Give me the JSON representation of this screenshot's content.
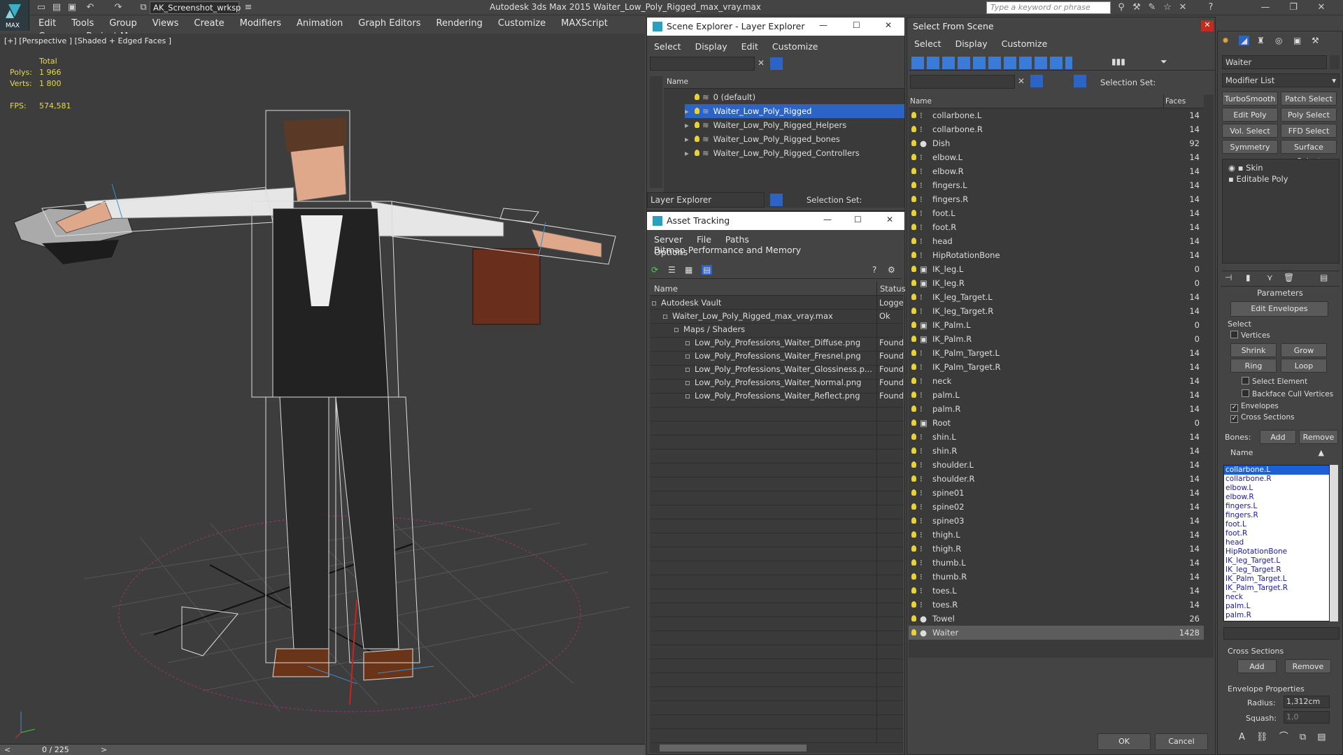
{
  "app": {
    "title": "Autodesk 3ds Max  2015    Waiter_Low_Poly_Rigged_max_vray.max",
    "workspace": "AK_Screenshot_wrksp",
    "search_placeholder": "Type a keyword or phrase",
    "logo_text": "MAX"
  },
  "menu": [
    "Edit",
    "Tools",
    "Group",
    "Views",
    "Create",
    "Modifiers",
    "Animation",
    "Graph Editors",
    "Rendering",
    "Customize",
    "MAXScript",
    "Corona",
    "Project Man"
  ],
  "viewport": {
    "label": "[+] [Perspective ] [Shaded + Edged Faces ]",
    "total_label": "Total",
    "polys_label": "Polys:",
    "polys_value": "1 966",
    "verts_label": "Verts:",
    "verts_value": "1 800",
    "fps_label": "FPS:",
    "fps_value": "574,581",
    "timeline": "0 / 225"
  },
  "scene_explorer": {
    "title": "Scene Explorer - Layer Explorer",
    "menu": [
      "Select",
      "Display",
      "Edit",
      "Customize"
    ],
    "column": "Name",
    "layers": [
      {
        "name": "0 (default)",
        "selected": false,
        "expand": false
      },
      {
        "name": "Waiter_Low_Poly_Rigged",
        "selected": true,
        "expand": true
      },
      {
        "name": "Waiter_Low_Poly_Rigged_Helpers",
        "selected": false,
        "expand": true
      },
      {
        "name": "Waiter_Low_Poly_Rigged_bones",
        "selected": false,
        "expand": true
      },
      {
        "name": "Waiter_Low_Poly_Rigged_Controllers",
        "selected": false,
        "expand": true
      }
    ],
    "footer_dropdown": "Layer Explorer",
    "selection_set": "Selection Set:"
  },
  "asset_tracking": {
    "title": "Asset Tracking",
    "menu": [
      "Server",
      "File",
      "Paths",
      "Bitmap Performance and Memory"
    ],
    "menu2": "Options",
    "col_name": "Name",
    "col_status": "Status",
    "rows": [
      {
        "name": "Autodesk Vault",
        "status": "Logge",
        "indent": 0
      },
      {
        "name": "Waiter_Low_Poly_Rigged_max_vray.max",
        "status": "Ok",
        "indent": 1
      },
      {
        "name": "Maps / Shaders",
        "status": "",
        "indent": 2
      },
      {
        "name": "Low_Poly_Professions_Waiter_Diffuse.png",
        "status": "Found",
        "indent": 3
      },
      {
        "name": "Low_Poly_Professions_Waiter_Fresnel.png",
        "status": "Found",
        "indent": 3
      },
      {
        "name": "Low_Poly_Professions_Waiter_Glossiness.p...",
        "status": "Found",
        "indent": 3
      },
      {
        "name": "Low_Poly_Professions_Waiter_Normal.png",
        "status": "Found",
        "indent": 3
      },
      {
        "name": "Low_Poly_Professions_Waiter_Reflect.png",
        "status": "Found",
        "indent": 3
      }
    ]
  },
  "select_from_scene": {
    "title": "Select From Scene",
    "menu": [
      "Select",
      "Display",
      "Customize"
    ],
    "selection_set": "Selection Set:",
    "col_name": "Name",
    "col_faces": "Faces",
    "ok": "OK",
    "cancel": "Cancel",
    "objects": [
      {
        "name": "collarbone.L",
        "faces": "14",
        "type": "bone"
      },
      {
        "name": "collarbone.R",
        "faces": "14",
        "type": "bone"
      },
      {
        "name": "Dish",
        "faces": "92",
        "type": "mesh"
      },
      {
        "name": "elbow.L",
        "faces": "14",
        "type": "bone"
      },
      {
        "name": "elbow.R",
        "faces": "14",
        "type": "bone"
      },
      {
        "name": "fingers.L",
        "faces": "14",
        "type": "bone"
      },
      {
        "name": "fingers.R",
        "faces": "14",
        "type": "bone"
      },
      {
        "name": "foot.L",
        "faces": "14",
        "type": "bone"
      },
      {
        "name": "foot.R",
        "faces": "14",
        "type": "bone"
      },
      {
        "name": "head",
        "faces": "14",
        "type": "bone"
      },
      {
        "name": "HipRotationBone",
        "faces": "14",
        "type": "bone"
      },
      {
        "name": "IK_leg.L",
        "faces": "0",
        "type": "ik"
      },
      {
        "name": "IK_leg.R",
        "faces": "0",
        "type": "ik"
      },
      {
        "name": "IK_leg_Target.L",
        "faces": "14",
        "type": "bone"
      },
      {
        "name": "IK_leg_Target.R",
        "faces": "14",
        "type": "bone"
      },
      {
        "name": "IK_Palm.L",
        "faces": "0",
        "type": "ik"
      },
      {
        "name": "IK_Palm.R",
        "faces": "0",
        "type": "ik"
      },
      {
        "name": "IK_Palm_Target.L",
        "faces": "14",
        "type": "bone"
      },
      {
        "name": "IK_Palm_Target.R",
        "faces": "14",
        "type": "bone"
      },
      {
        "name": "neck",
        "faces": "14",
        "type": "bone"
      },
      {
        "name": "palm.L",
        "faces": "14",
        "type": "bone"
      },
      {
        "name": "palm.R",
        "faces": "14",
        "type": "bone"
      },
      {
        "name": "Root",
        "faces": "0",
        "type": "ik"
      },
      {
        "name": "shin.L",
        "faces": "14",
        "type": "bone"
      },
      {
        "name": "shin.R",
        "faces": "14",
        "type": "bone"
      },
      {
        "name": "shoulder.L",
        "faces": "14",
        "type": "bone"
      },
      {
        "name": "shoulder.R",
        "faces": "14",
        "type": "bone"
      },
      {
        "name": "spine01",
        "faces": "14",
        "type": "bone"
      },
      {
        "name": "spine02",
        "faces": "14",
        "type": "bone"
      },
      {
        "name": "spine03",
        "faces": "14",
        "type": "bone"
      },
      {
        "name": "thigh.L",
        "faces": "14",
        "type": "bone"
      },
      {
        "name": "thigh.R",
        "faces": "14",
        "type": "bone"
      },
      {
        "name": "thumb.L",
        "faces": "14",
        "type": "bone"
      },
      {
        "name": "thumb.R",
        "faces": "14",
        "type": "bone"
      },
      {
        "name": "toes.L",
        "faces": "14",
        "type": "bone"
      },
      {
        "name": "toes.R",
        "faces": "14",
        "type": "bone"
      },
      {
        "name": "Towel",
        "faces": "26",
        "type": "mesh"
      },
      {
        "name": "Waiter",
        "faces": "1428",
        "type": "mesh"
      }
    ]
  },
  "command_panel": {
    "object_name": "Waiter",
    "modifier_list": "Modifier List",
    "buttons": [
      "TurboSmooth",
      "Patch Select",
      "Edit Poly",
      "Poly Select",
      "Vol. Select",
      "FFD Select",
      "Symmetry",
      "Surface Select"
    ],
    "stack": [
      "Skin",
      "Editable Poly"
    ],
    "params_title": "Parameters",
    "edit_envelopes": "Edit Envelopes",
    "select_label": "Select",
    "vertices": "Vertices",
    "shrink": "Shrink",
    "grow": "Grow",
    "ring": "Ring",
    "loop": "Loop",
    "select_element": "Select Element",
    "backface_cull": "Backface Cull Vertices",
    "envelopes": "Envelopes",
    "cross_sections": "Cross Sections",
    "bones_label": "Bones:",
    "add": "Add",
    "remove": "Remove",
    "name_col": "Name",
    "bones": [
      "collarbone.L",
      "collarbone.R",
      "elbow.L",
      "elbow.R",
      "fingers.L",
      "fingers.R",
      "foot.L",
      "foot.R",
      "head",
      "HipRotationBone",
      "IK_leg_Target.L",
      "IK_leg_Target.R",
      "IK_Palm_Target.L",
      "IK_Palm_Target.R",
      "neck",
      "palm.L",
      "palm.R"
    ],
    "cross_sections_group": "Cross Sections",
    "cs_add": "Add",
    "cs_remove": "Remove",
    "envelope_props": "Envelope Properties",
    "radius_label": "Radius:",
    "radius_value": "1,312cm",
    "squash_label": "Squash:",
    "squash_value": "1,0"
  }
}
